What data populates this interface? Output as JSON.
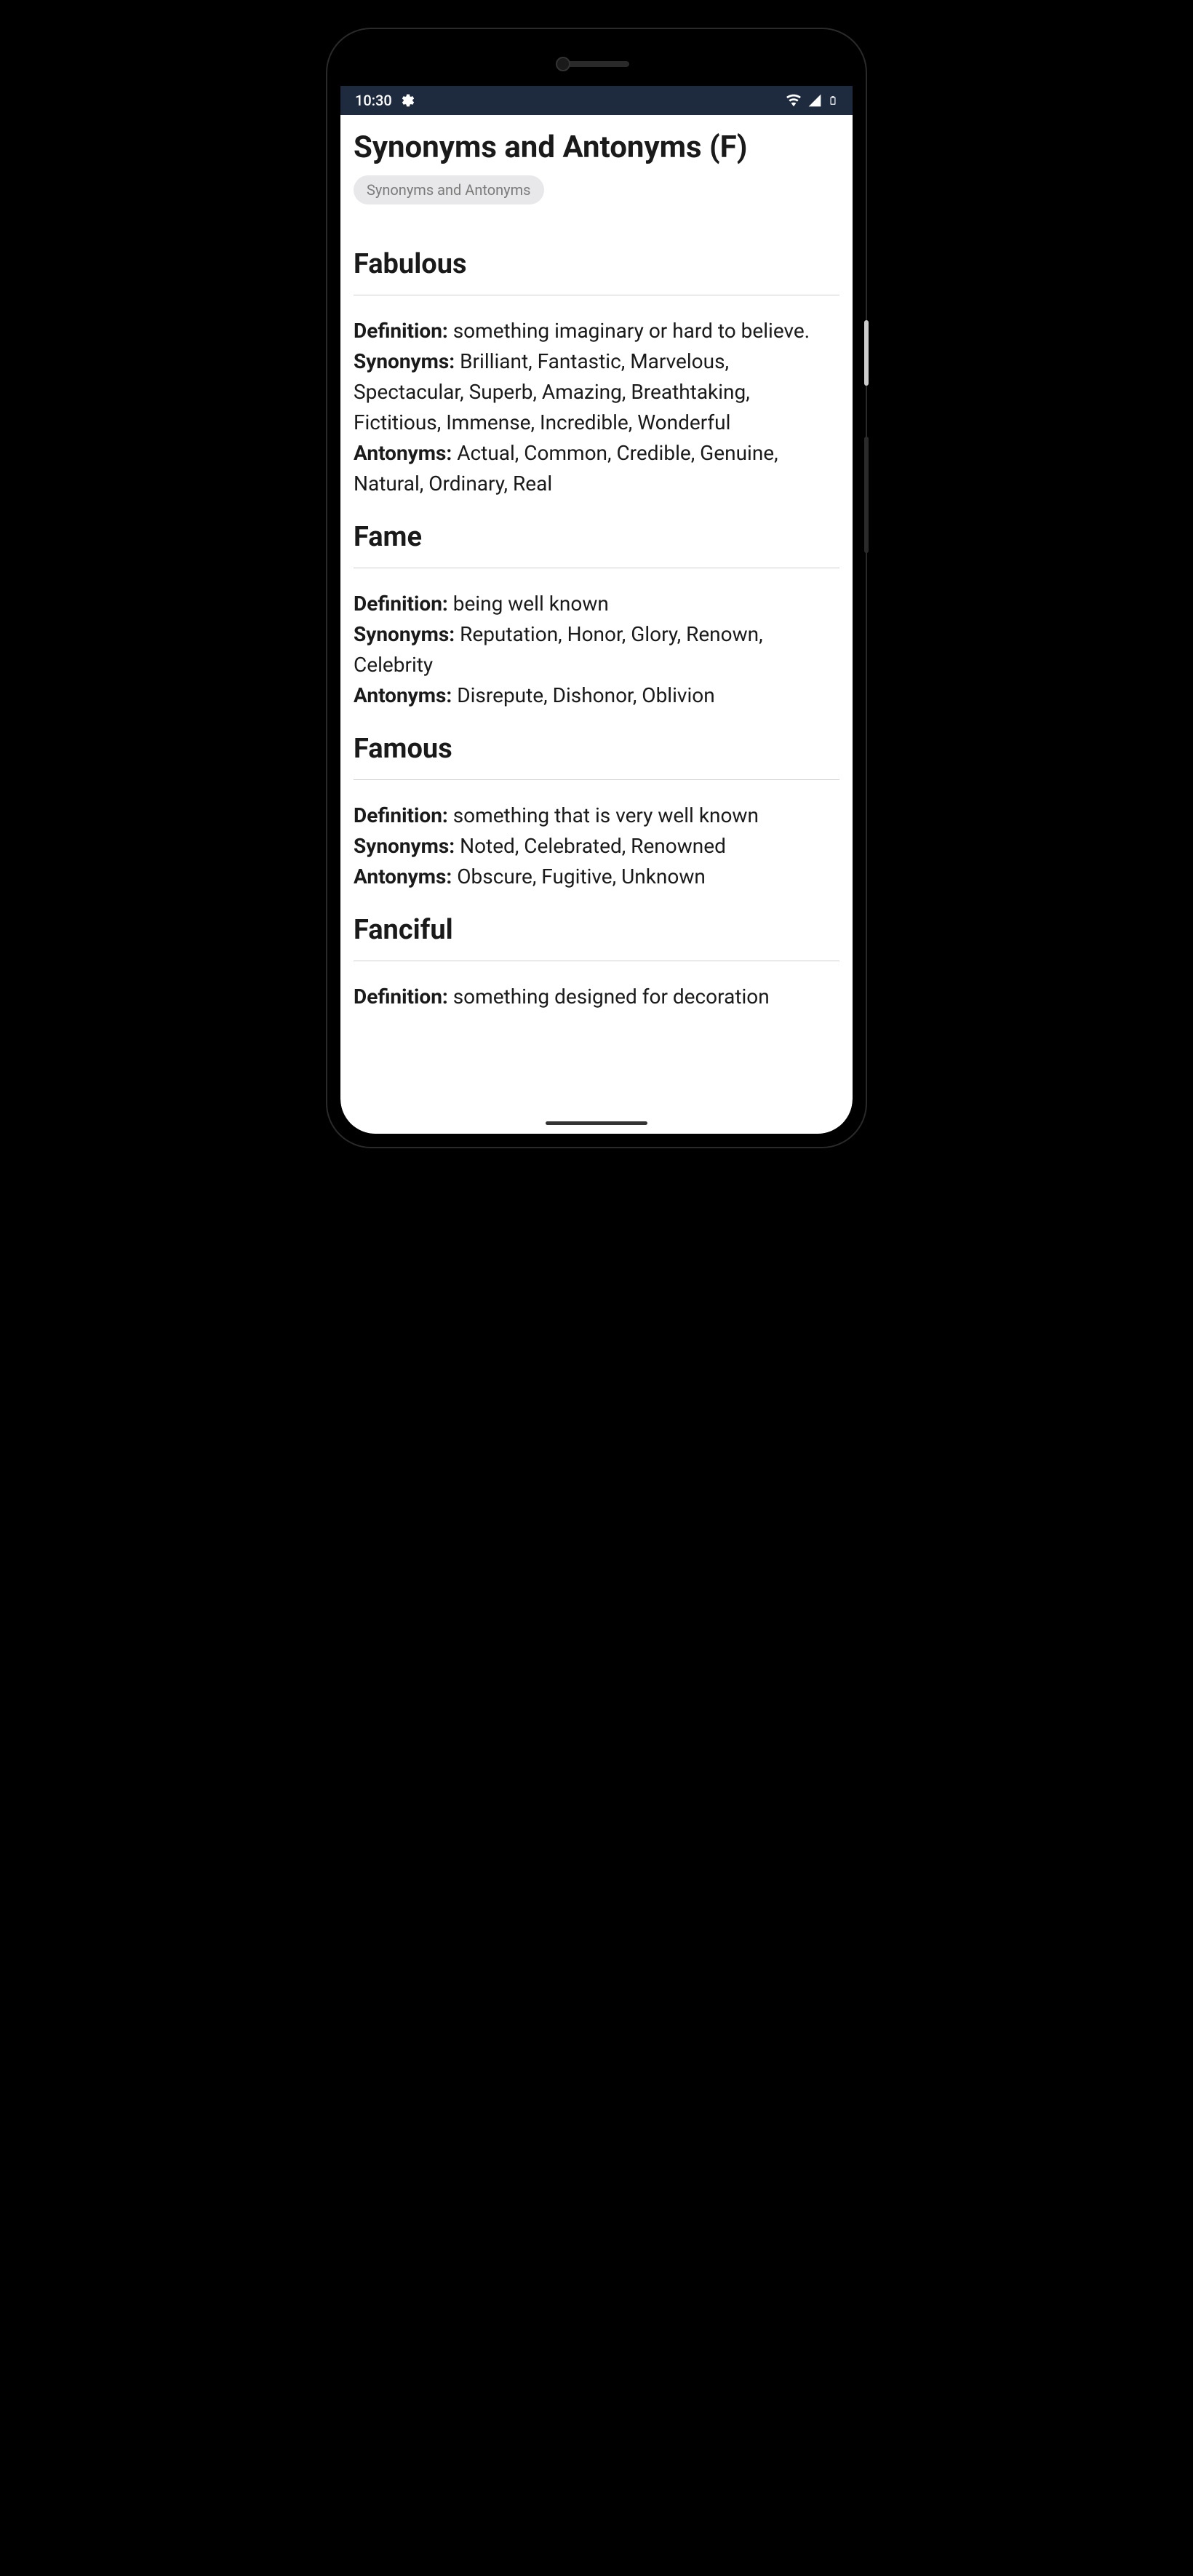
{
  "statusBar": {
    "time": "10:30"
  },
  "page": {
    "title": "Synonyms and Antonyms (F)",
    "categoryTag": "Synonyms and Antonyms"
  },
  "labels": {
    "definition": "Definition:",
    "synonyms": "Synonyms:",
    "antonyms": "Antonyms:"
  },
  "entries": [
    {
      "word": "Fabulous",
      "definition": "something imaginary or hard to believe.",
      "synonyms": "Brilliant, Fantastic, Marvelous, Spectacular, Superb, Amazing, Breathtaking, Fictitious, Immense, Incredible, Wonderful",
      "antonyms": "Actual, Common, Credible, Genuine, Natural, Ordinary, Real"
    },
    {
      "word": "Fame",
      "definition": "being well known",
      "synonyms": "Reputation, Honor, Glory, Renown, Celebrity",
      "antonyms": "Disrepute, Dishonor, Oblivion"
    },
    {
      "word": "Famous",
      "definition": "something that is very well known",
      "synonyms": "Noted, Celebrated, Renowned",
      "antonyms": "Obscure, Fugitive, Unknown"
    },
    {
      "word": "Fanciful",
      "definition": "something designed for decoration",
      "synonyms": "",
      "antonyms": ""
    }
  ]
}
